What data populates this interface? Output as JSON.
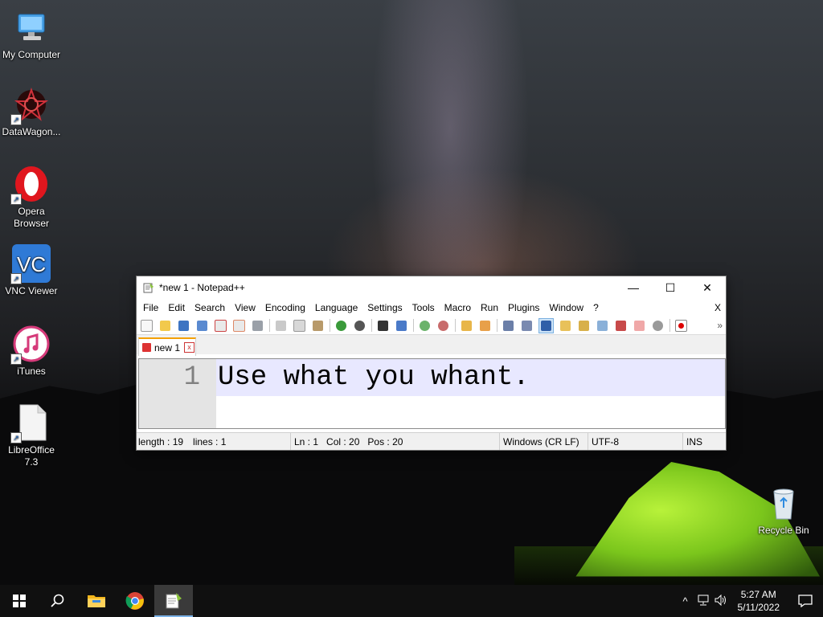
{
  "desktop": {
    "icons": [
      {
        "label": "My Computer"
      },
      {
        "label": "DataWagon..."
      },
      {
        "label": "Opera Browser"
      },
      {
        "label": "VNC Viewer"
      },
      {
        "label": "iTunes"
      },
      {
        "label": "LibreOffice 7.3"
      },
      {
        "label": "Recycle Bin"
      }
    ]
  },
  "notepad": {
    "title": "*new 1 - Notepad++",
    "menu": [
      "File",
      "Edit",
      "Search",
      "View",
      "Encoding",
      "Language",
      "Settings",
      "Tools",
      "Macro",
      "Run",
      "Plugins",
      "Window",
      "?"
    ],
    "menu_close": "X",
    "toolbar_overflow": "»",
    "tab": {
      "label": "new 1",
      "close": "x"
    },
    "editor": {
      "line_number": "1",
      "text": "Use what you whant."
    },
    "status": {
      "length": "length : 19",
      "lines": "lines : 1",
      "ln": "Ln : 1",
      "col": "Col : 20",
      "pos": "Pos : 20",
      "eol": "Windows (CR LF)",
      "encoding": "UTF-8",
      "mode": "INS"
    },
    "window_controls": {
      "minimize": "—",
      "maximize": "☐",
      "close": "✕"
    }
  },
  "taskbar": {
    "apps": [
      "start",
      "search",
      "file-explorer",
      "chrome",
      "notepad++"
    ],
    "tray_icons": [
      "^",
      "network",
      "volume"
    ],
    "clock": {
      "time": "5:27 AM",
      "date": "5/11/2022"
    }
  },
  "colors": {
    "accent_tab": "#f4a000",
    "current_line": "#e8e8ff",
    "tent": "#7bc61c"
  }
}
